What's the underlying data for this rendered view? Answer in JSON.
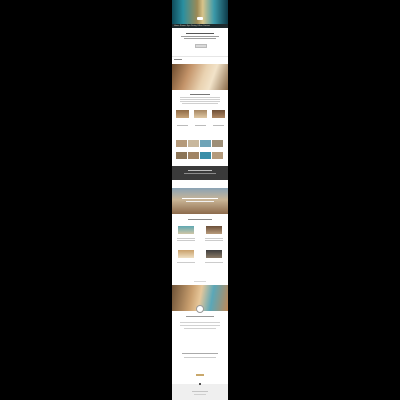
{
  "site": {
    "nav_items": [
      "Home",
      "Rooms",
      "Spa",
      "Dining",
      "Offers",
      "Contact"
    ],
    "intro_button": "",
    "reserve_button": ""
  },
  "colors": {
    "accent": "#c9a86b",
    "dark": "#3a3a3a",
    "teal": "#2a8fa0"
  },
  "icons": [
    "logo-mark-icon",
    "emblem-icon"
  ]
}
